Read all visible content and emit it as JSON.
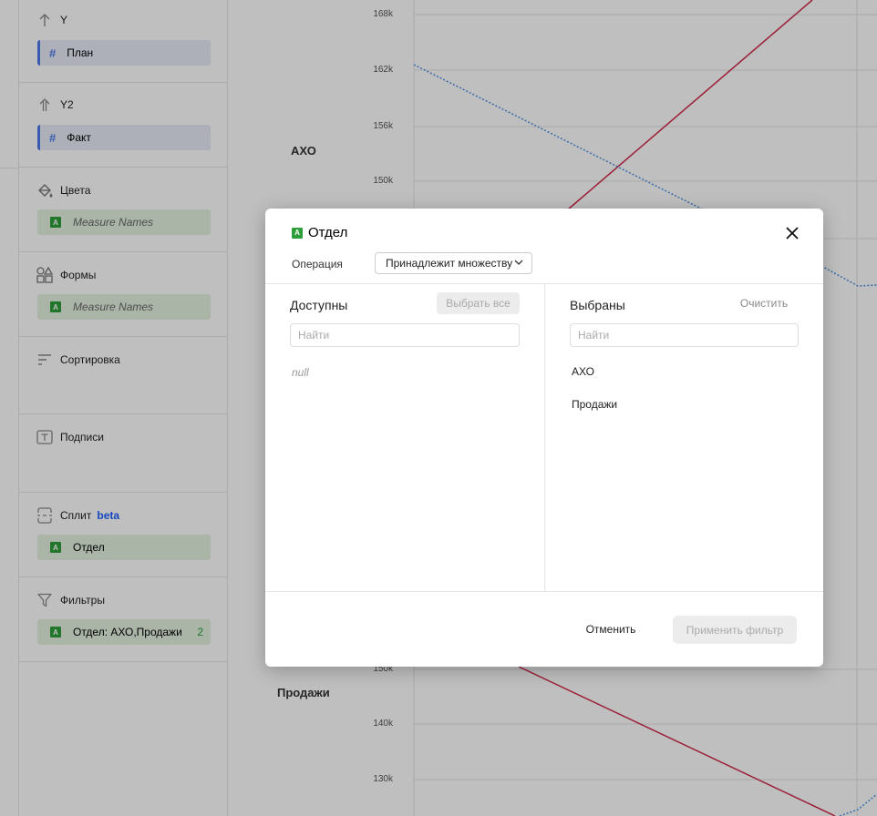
{
  "sidebar": {
    "sections": [
      {
        "title": "Y",
        "icon": "arrow-up-icon",
        "chips": [
          {
            "label": "План",
            "kind": "measure"
          }
        ]
      },
      {
        "title": "Y2",
        "icon": "double-arrow-up-icon",
        "chips": [
          {
            "label": "Факт",
            "kind": "measure"
          }
        ]
      },
      {
        "title": "Цвета",
        "icon": "paint-bucket-icon",
        "chips": [
          {
            "label": "Measure Names",
            "kind": "dim"
          }
        ]
      },
      {
        "title": "Формы",
        "icon": "shapes-icon",
        "chips": [
          {
            "label": "Measure Names",
            "kind": "dim"
          }
        ]
      },
      {
        "title": "Сортировка",
        "icon": "sort-icon",
        "chips": []
      },
      {
        "title": "Подписи",
        "icon": "label-icon",
        "chips": []
      },
      {
        "title": "Сплит",
        "badge": "beta",
        "icon": "split-icon",
        "chips": [
          {
            "label": "Отдел",
            "kind": "dim"
          }
        ]
      },
      {
        "title": "Фильтры",
        "icon": "filter-icon",
        "chips": [
          {
            "label": "Отдел: АХО,Продажи",
            "kind": "dim",
            "count": "2"
          }
        ]
      }
    ]
  },
  "chart": {
    "split_labels": [
      "АХО",
      "Продажи"
    ],
    "top_ticks": [
      "168k",
      "162k",
      "156k",
      "150k"
    ],
    "bottom_ticks": [
      "150k",
      "140k",
      "130k"
    ],
    "colors": {
      "plan": "#d0284a",
      "fact": "#4a90e2"
    }
  },
  "modal": {
    "title": "Отдел",
    "close_icon": "close-icon",
    "operation_label": "Операция",
    "operation_value": "Принадлежит множеству",
    "available": {
      "title": "Доступны",
      "select_all": "Выбрать все",
      "search_placeholder": "Найти",
      "items": [
        "null"
      ]
    },
    "selected": {
      "title": "Выбраны",
      "clear": "Очистить",
      "search_placeholder": "Найти",
      "items": [
        "АХО",
        "Продажи"
      ]
    },
    "cancel": "Отменить",
    "apply": "Применить фильтр"
  }
}
